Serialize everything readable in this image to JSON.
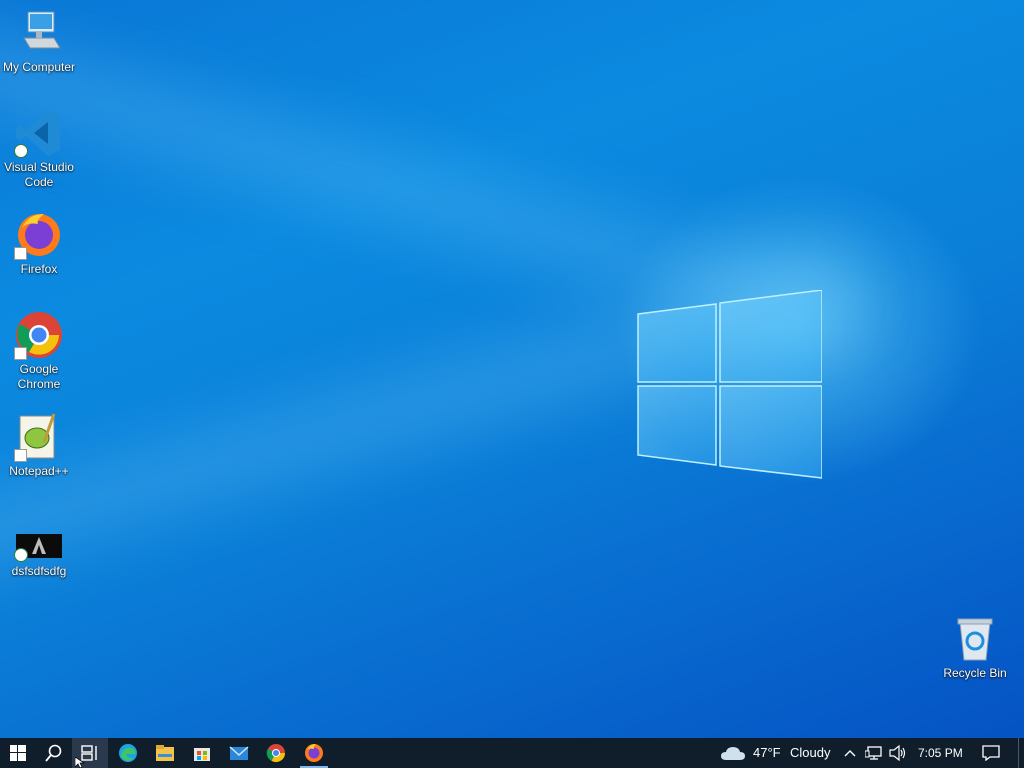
{
  "desktop": {
    "icons": [
      {
        "label": "My Computer",
        "icon": "computer-icon"
      },
      {
        "label": "Visual Studio Code",
        "icon": "vscode-icon"
      },
      {
        "label": "Firefox",
        "icon": "firefox-icon"
      },
      {
        "label": "Google Chrome",
        "icon": "chrome-icon"
      },
      {
        "label": "Notepad++",
        "icon": "notepadpp-icon"
      },
      {
        "label": "dsfsdfsdfg",
        "icon": "app-thumbnail-icon"
      },
      {
        "label": "Recycle Bin",
        "icon": "recycle-bin-icon"
      }
    ]
  },
  "taskbar": {
    "buttons": [
      "start-icon",
      "search-icon",
      "task-view-icon",
      "edge-icon",
      "file-explorer-icon",
      "store-icon",
      "mail-icon",
      "chrome-icon",
      "firefox-icon"
    ],
    "weather": {
      "temp": "47°F",
      "condition": "Cloudy"
    },
    "clock": "7:05 PM"
  },
  "colors": {
    "taskbar": "#101d2b",
    "desktop_accent": "#0a78d6"
  }
}
